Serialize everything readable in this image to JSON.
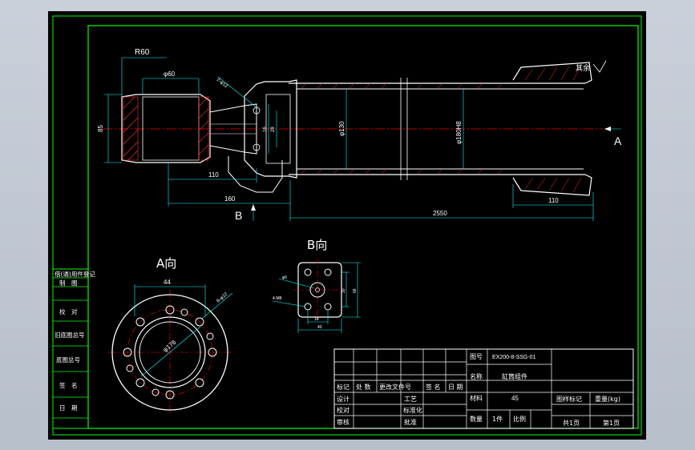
{
  "colors": {
    "background": "#000000",
    "frame": "#00ff00",
    "object": "#ffffff",
    "center": "#ff0000",
    "dimension": "#00ffff",
    "hatch": "#ff3030",
    "text": "#ffffff"
  },
  "main_view": {
    "radius_label": "R60",
    "dims": {
      "d60": "φ60",
      "h85": "85",
      "l110_left": "110",
      "l160": "160",
      "d130": "φ130",
      "bore": "φ180H8",
      "l2550": "2550",
      "l110_right": "110",
      "hole_small": "2-φ12",
      "d28": "28",
      "d16": "16",
      "rough": "其余"
    },
    "section_labels": {
      "a": "A",
      "b": "B"
    }
  },
  "view_a": {
    "title": "A向",
    "dim_44": "44",
    "dim_bolt": "8-φ22",
    "dim_176": "φ176"
  },
  "view_b": {
    "title": "B向",
    "dim_hole": "φ6",
    "dim_thread": "4-M8",
    "dim_30": "30",
    "dim_68": "68",
    "dim_18": "18",
    "dim_16": "16",
    "dim_40": "40"
  },
  "left_strip": [
    "借(通)用件登记",
    "制　图",
    "",
    "校　对",
    "旧底图总号",
    "底图总号",
    "签　名",
    "日　期"
  ],
  "title_block": {
    "drawing_no_label": "图号",
    "drawing_no": "EX200-8-SSG-01",
    "name_label": "名称",
    "name": "缸筒组件",
    "material_label": "材料",
    "material": "45",
    "quantity_label": "数量",
    "quantity": "1件",
    "scale_label": "比例",
    "stage_label": "图样标记",
    "weight_label": "重量(kg)",
    "total_pages": "共1页",
    "page": "第1页",
    "rev_cols": [
      "标记",
      "处 数",
      "更改文件号",
      "签 名",
      "日 期"
    ],
    "design": "设计",
    "process": "工艺",
    "check": "校对",
    "standard": "标准化",
    "review": "审核",
    "approve": "批准"
  }
}
